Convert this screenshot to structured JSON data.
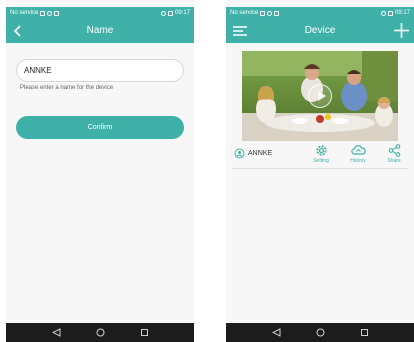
{
  "colors": {
    "accent": "#3fb1a9",
    "nav_bar": "#1c1c1c",
    "background": "#f7f7f7"
  },
  "status_bar": {
    "carrier": "No service",
    "time": "09:17"
  },
  "name_screen": {
    "title": "Name",
    "input_value": "ANNKE",
    "hint": "Please enter a name for the device",
    "confirm_label": "Confirm"
  },
  "device_screen": {
    "title": "Device",
    "device_name": "ANNKE",
    "actions": [
      {
        "label": "Setting",
        "icon": "gear-icon"
      },
      {
        "label": "History",
        "icon": "cloud-icon"
      },
      {
        "label": "Share",
        "icon": "share-icon"
      }
    ]
  },
  "nav": {
    "icons": [
      "back-triangle-icon",
      "home-circle-icon",
      "recents-square-icon"
    ]
  }
}
